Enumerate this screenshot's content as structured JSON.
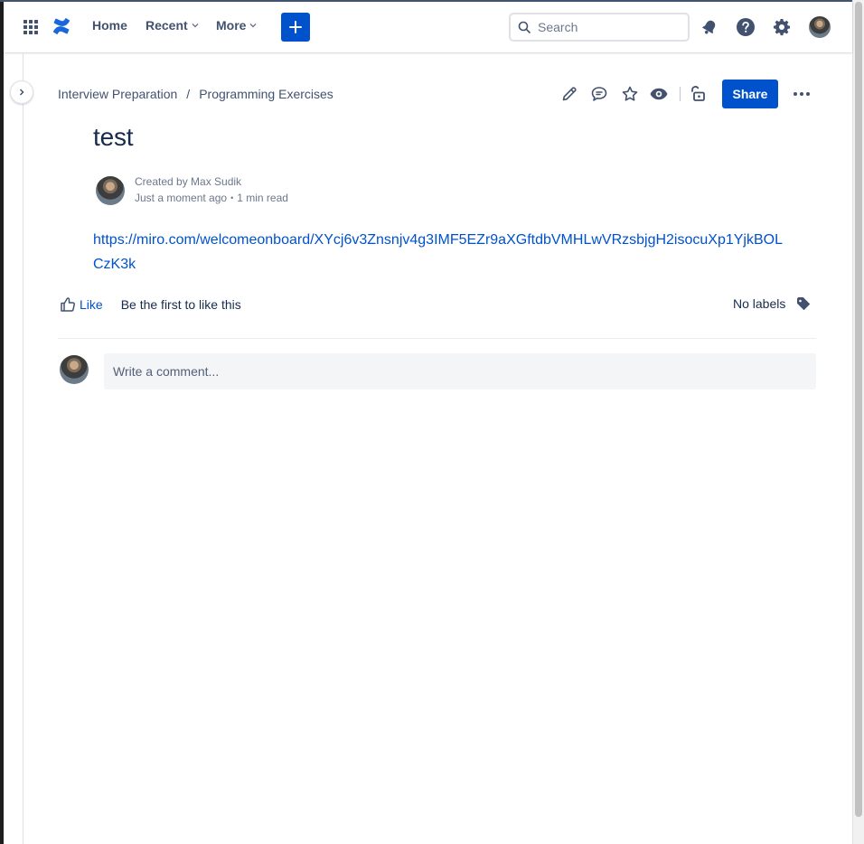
{
  "topnav": {
    "home_label": "Home",
    "recent_label": "Recent",
    "more_label": "More",
    "search_placeholder": "Search"
  },
  "breadcrumb": {
    "items": [
      "Interview Preparation",
      "Programming Exercises"
    ],
    "separator": "/"
  },
  "page_actions": {
    "share_label": "Share"
  },
  "page": {
    "title": "test",
    "byline_created": "Created by Max Sudik",
    "byline_time": "Just a moment ago",
    "byline_dot": "•",
    "byline_read": "1 min read",
    "link": "https://miro.com/welcomeonboard/XYcj6v3Znsnjv4g3IMF5EZr9aXGftdbVMHLwVRzsbjgH2isocuXp1YjkBOLCzK3k"
  },
  "reactions": {
    "like_label": "Like",
    "like_text": "Be the first to like this",
    "labels_text": "No labels"
  },
  "comment": {
    "placeholder": "Write a comment..."
  },
  "colors": {
    "brand": "#0052cc",
    "text": "#172b4d",
    "subtle": "#6b778c"
  }
}
